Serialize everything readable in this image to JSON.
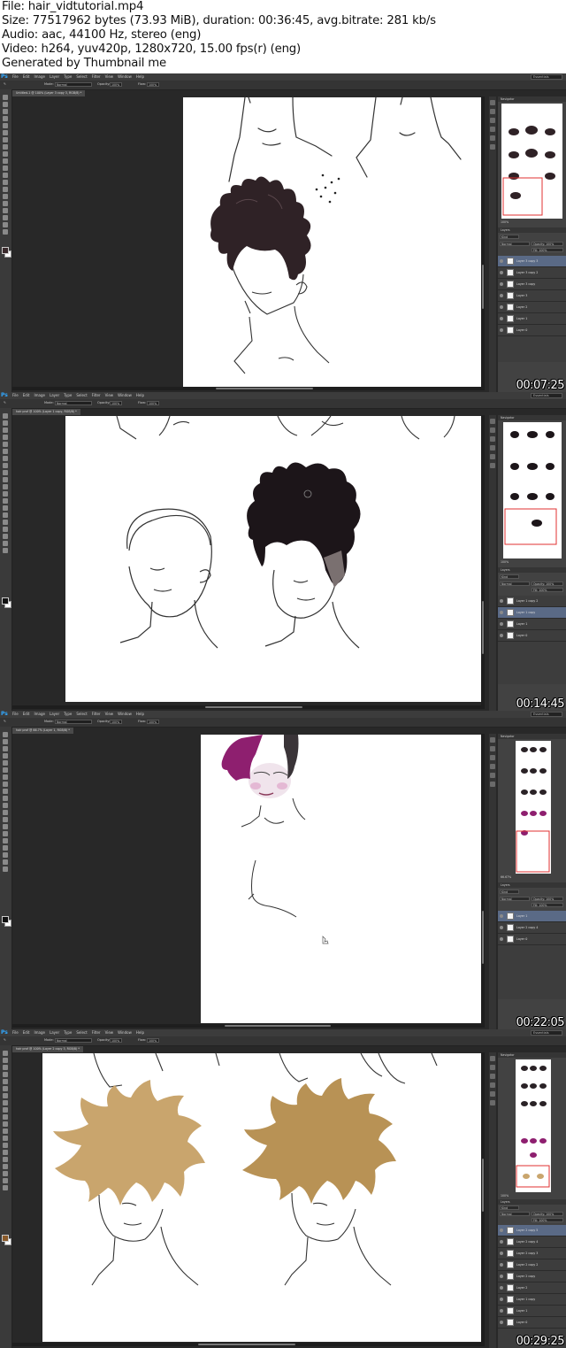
{
  "header": {
    "file": "File: hair_vidtutorial.mp4",
    "size": "Size: 77517962 bytes (73.93 MiB), duration: 00:36:45, avg.bitrate: 281 kb/s",
    "audio": "Audio: aac, 44100 Hz, stereo (eng)",
    "video": "Video: h264, yuv420p, 1280x720, 15.00 fps(r) (eng)",
    "generator": "Generated by Thumbnail me"
  },
  "app": {
    "logo": "Ps",
    "menu": [
      "File",
      "Edit",
      "Image",
      "Layer",
      "Type",
      "Select",
      "Filter",
      "View",
      "Window",
      "Help"
    ],
    "workspace": "Essentials",
    "options": {
      "mode_label": "Mode:",
      "mode_value": "Normal",
      "opacity_label": "Opacity:",
      "opacity_value": "100%",
      "flow_label": "Flow:",
      "flow_value": "100%"
    },
    "panel_labels": {
      "navigator": "Navigator",
      "layers": "Layers",
      "channels": "Channels",
      "paths": "Paths"
    },
    "layer_controls": {
      "kind": "Kind",
      "blend": "Normal",
      "opacity": "Opacity: 100%",
      "lock": "Lock:",
      "fill": "Fill: 100%"
    }
  },
  "frames": [
    {
      "timestamp": "00:07:25",
      "doc_tab": "Untitled-1 @ 100% (Layer 3 copy 3, RGB/8) *",
      "zoom": "100%",
      "layers": [
        "Layer 3 copy 3",
        "Layer 3 copy 2",
        "Layer 3 copy",
        "Layer 3",
        "Layer 2",
        "Layer 1",
        "Layer 0"
      ],
      "selected_layer": 0
    },
    {
      "timestamp": "00:14:45",
      "doc_tab": "hair prof @ 100% (Layer 1 copy, RGB/8) *",
      "zoom": "100%",
      "layers": [
        "Layer 1 copy 2",
        "Layer 1 copy",
        "Layer 1",
        "Layer 0"
      ],
      "selected_layer": 1
    },
    {
      "timestamp": "00:22:05",
      "doc_tab": "hair prof @ 66.7% (Layer 1, RGB/8) *",
      "zoom": "66.67%",
      "layers": [
        "Layer 1",
        "Layer 2 copy 4",
        "Layer 0"
      ],
      "selected_layer": 0
    },
    {
      "timestamp": "00:29:25",
      "doc_tab": "hair prof @ 100% (Layer 2 copy 3, RGB/8) *",
      "zoom": "100%",
      "layers": [
        "Layer 2 copy 5",
        "Layer 2 copy 4",
        "Layer 2 copy 3",
        "Layer 2 copy 2",
        "Layer 2 copy",
        "Layer 2",
        "Layer 1 copy",
        "Layer 1",
        "Layer 0"
      ],
      "selected_layer": 0
    }
  ],
  "colors": {
    "dark_hair": "#2f2226",
    "black_hair": "#1c1519",
    "magenta_hair": "#8e1f6f",
    "blonde_hair": "#c9a56d",
    "selection": "#5a6a86",
    "nav_frame": "#e03030"
  }
}
